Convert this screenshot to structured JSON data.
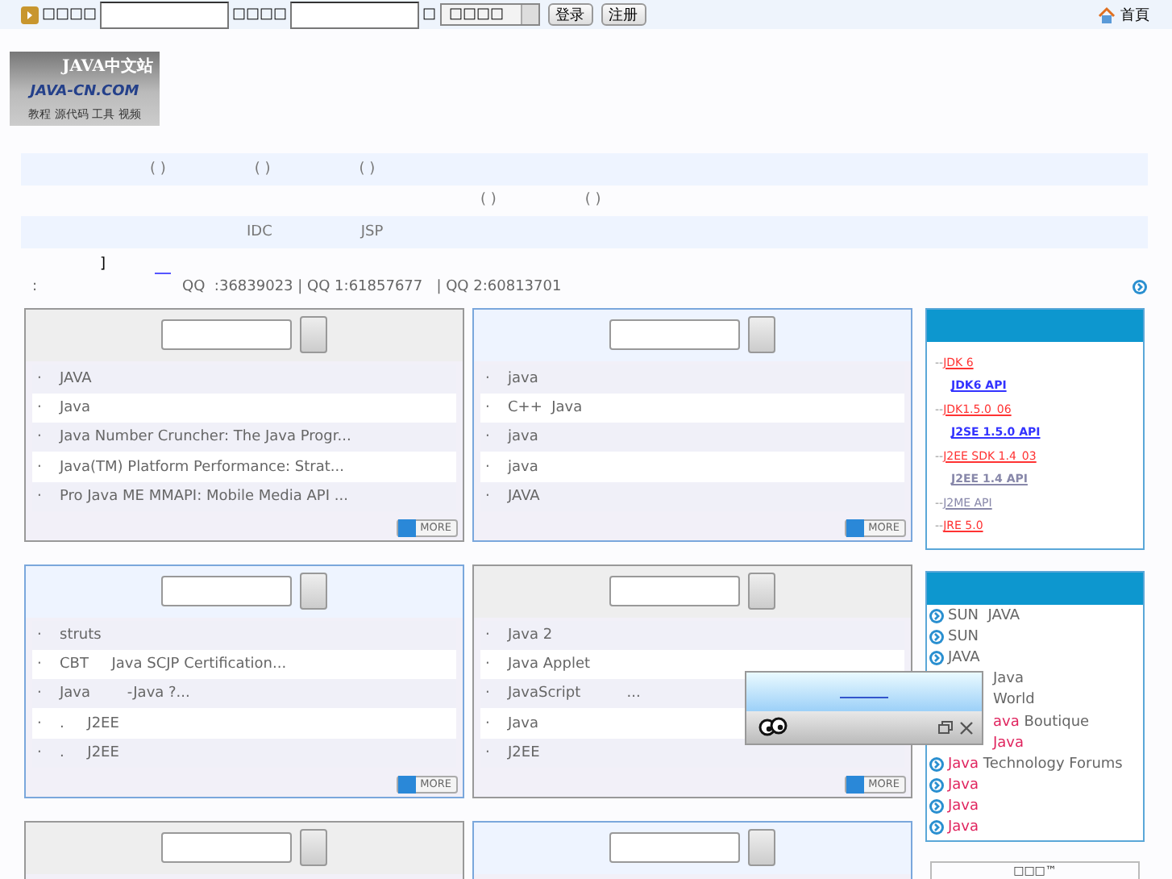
{
  "top_bar": {
    "user_label": "□□□□",
    "password_label": "□□□□",
    "separator": "□",
    "select_value": "□□□□",
    "buttons": [
      "登录",
      "注册"
    ],
    "home_link": "首頁"
  },
  "logo": {
    "title": "JAVA中文站",
    "domain": "JAVA-CN.COM",
    "tagline": "教程 源代码 工具 视频"
  },
  "nav_rows": [
    {
      "items": [
        "( )",
        "( )",
        "( )"
      ]
    },
    {
      "items": [
        "( )",
        "( )"
      ]
    },
    {
      "items": [
        "IDC",
        "JSP"
      ]
    }
  ],
  "notice": {
    "bracket": "]",
    "contact_label": ":",
    "contacts": "QQ  :36839023 | QQ 1:61857677   | QQ 2:60813701"
  },
  "panels": [
    {
      "kind": "gray",
      "items": [
        {
          "bullet": "·",
          "text": "JAVA"
        },
        {
          "bullet": "·",
          "text": "Java"
        },
        {
          "bullet": "·",
          "text": "Java Number Cruncher: The Java Progr..."
        },
        {
          "bullet": "·",
          "text": "Java(TM) Platform Performance: Strat..."
        },
        {
          "bullet": "·",
          "text": "Pro Java ME MMAPI: Mobile Media API ..."
        }
      ],
      "more": "MORE"
    },
    {
      "kind": "blue",
      "items": [
        {
          "bullet": "·",
          "text": "java"
        },
        {
          "bullet": "·",
          "text": "C++  Java"
        },
        {
          "bullet": "·",
          "text": "java"
        },
        {
          "bullet": "·",
          "text": "java"
        },
        {
          "bullet": "·",
          "text": "JAVA"
        }
      ],
      "more": "MORE"
    },
    {
      "kind": "blue",
      "items": [
        {
          "bullet": "·",
          "text": "struts"
        },
        {
          "bullet": "·",
          "text": "CBT     Java SCJP Certification..."
        },
        {
          "bullet": "·",
          "text": "Java        -Java ?..."
        },
        {
          "bullet": "·",
          "text": ".     J2EE"
        },
        {
          "bullet": "·",
          "text": ".     J2EE"
        }
      ],
      "more": "MORE"
    },
    {
      "kind": "gray",
      "items": [
        {
          "bullet": "·",
          "text": "Java 2"
        },
        {
          "bullet": "·",
          "text": "Java Applet"
        },
        {
          "bullet": "·",
          "text": "JavaScript          ..."
        },
        {
          "bullet": "·",
          "text": "Java"
        },
        {
          "bullet": "·",
          "text": "J2EE"
        }
      ],
      "more": "MORE"
    },
    {
      "kind": "gray"
    },
    {
      "kind": "blue"
    }
  ],
  "sidebar": {
    "downloads": [
      {
        "kind": "top",
        "prefix": "--",
        "text": "JDK 6",
        "color": "#ff3333"
      },
      {
        "kind": "sub",
        "text": "JDK6 API",
        "color": "#3333ff"
      },
      {
        "kind": "top",
        "prefix": "--",
        "text": "JDK1.5.0_06",
        "color": "#ff3333"
      },
      {
        "kind": "sub",
        "text": "J2SE 1.5.0 API",
        "color": "#3333ff"
      },
      {
        "kind": "top",
        "prefix": "--",
        "text": "J2EE SDK 1.4_03",
        "color": "#ff3333"
      },
      {
        "kind": "sub",
        "text": "J2EE 1.4 API",
        "color": "#8888aa"
      },
      {
        "kind": "top",
        "prefix": "--",
        "text": "J2ME API",
        "color": "#8888aa"
      },
      {
        "kind": "top",
        "prefix": "--",
        "text": "JRE 5.0",
        "color": "#ff3333"
      }
    ],
    "links": [
      {
        "parts": [
          {
            "text": "SUN  JAVA",
            "hot": false
          }
        ],
        "covered": false
      },
      {
        "parts": [
          {
            "text": "SUN",
            "hot": false
          }
        ],
        "covered": false
      },
      {
        "parts": [
          {
            "text": "JAVA",
            "hot": false
          }
        ],
        "covered": false
      },
      {
        "parts": [
          {
            "text": "Java",
            "hot": false
          }
        ],
        "covered": true
      },
      {
        "parts": [
          {
            "text": "World",
            "hot": false
          }
        ],
        "covered": true
      },
      {
        "parts": [
          {
            "text": "ava",
            "hot": true
          },
          {
            "text": " Boutique",
            "hot": false
          }
        ],
        "covered": true
      },
      {
        "parts": [
          {
            "text": "Java",
            "hot": true
          }
        ],
        "covered": true
      },
      {
        "parts": [
          {
            "text": "Java",
            "hot": true
          },
          {
            "text": " Technology Forums",
            "hot": false
          }
        ],
        "covered": false
      },
      {
        "parts": [
          {
            "text": "Java",
            "hot": true
          }
        ],
        "covered": false
      },
      {
        "parts": [
          {
            "text": "Java",
            "hot": true
          }
        ],
        "covered": false
      },
      {
        "parts": [
          {
            "text": "Java",
            "hot": true
          }
        ],
        "covered": false
      }
    ],
    "bottom_box": "□□□™"
  }
}
